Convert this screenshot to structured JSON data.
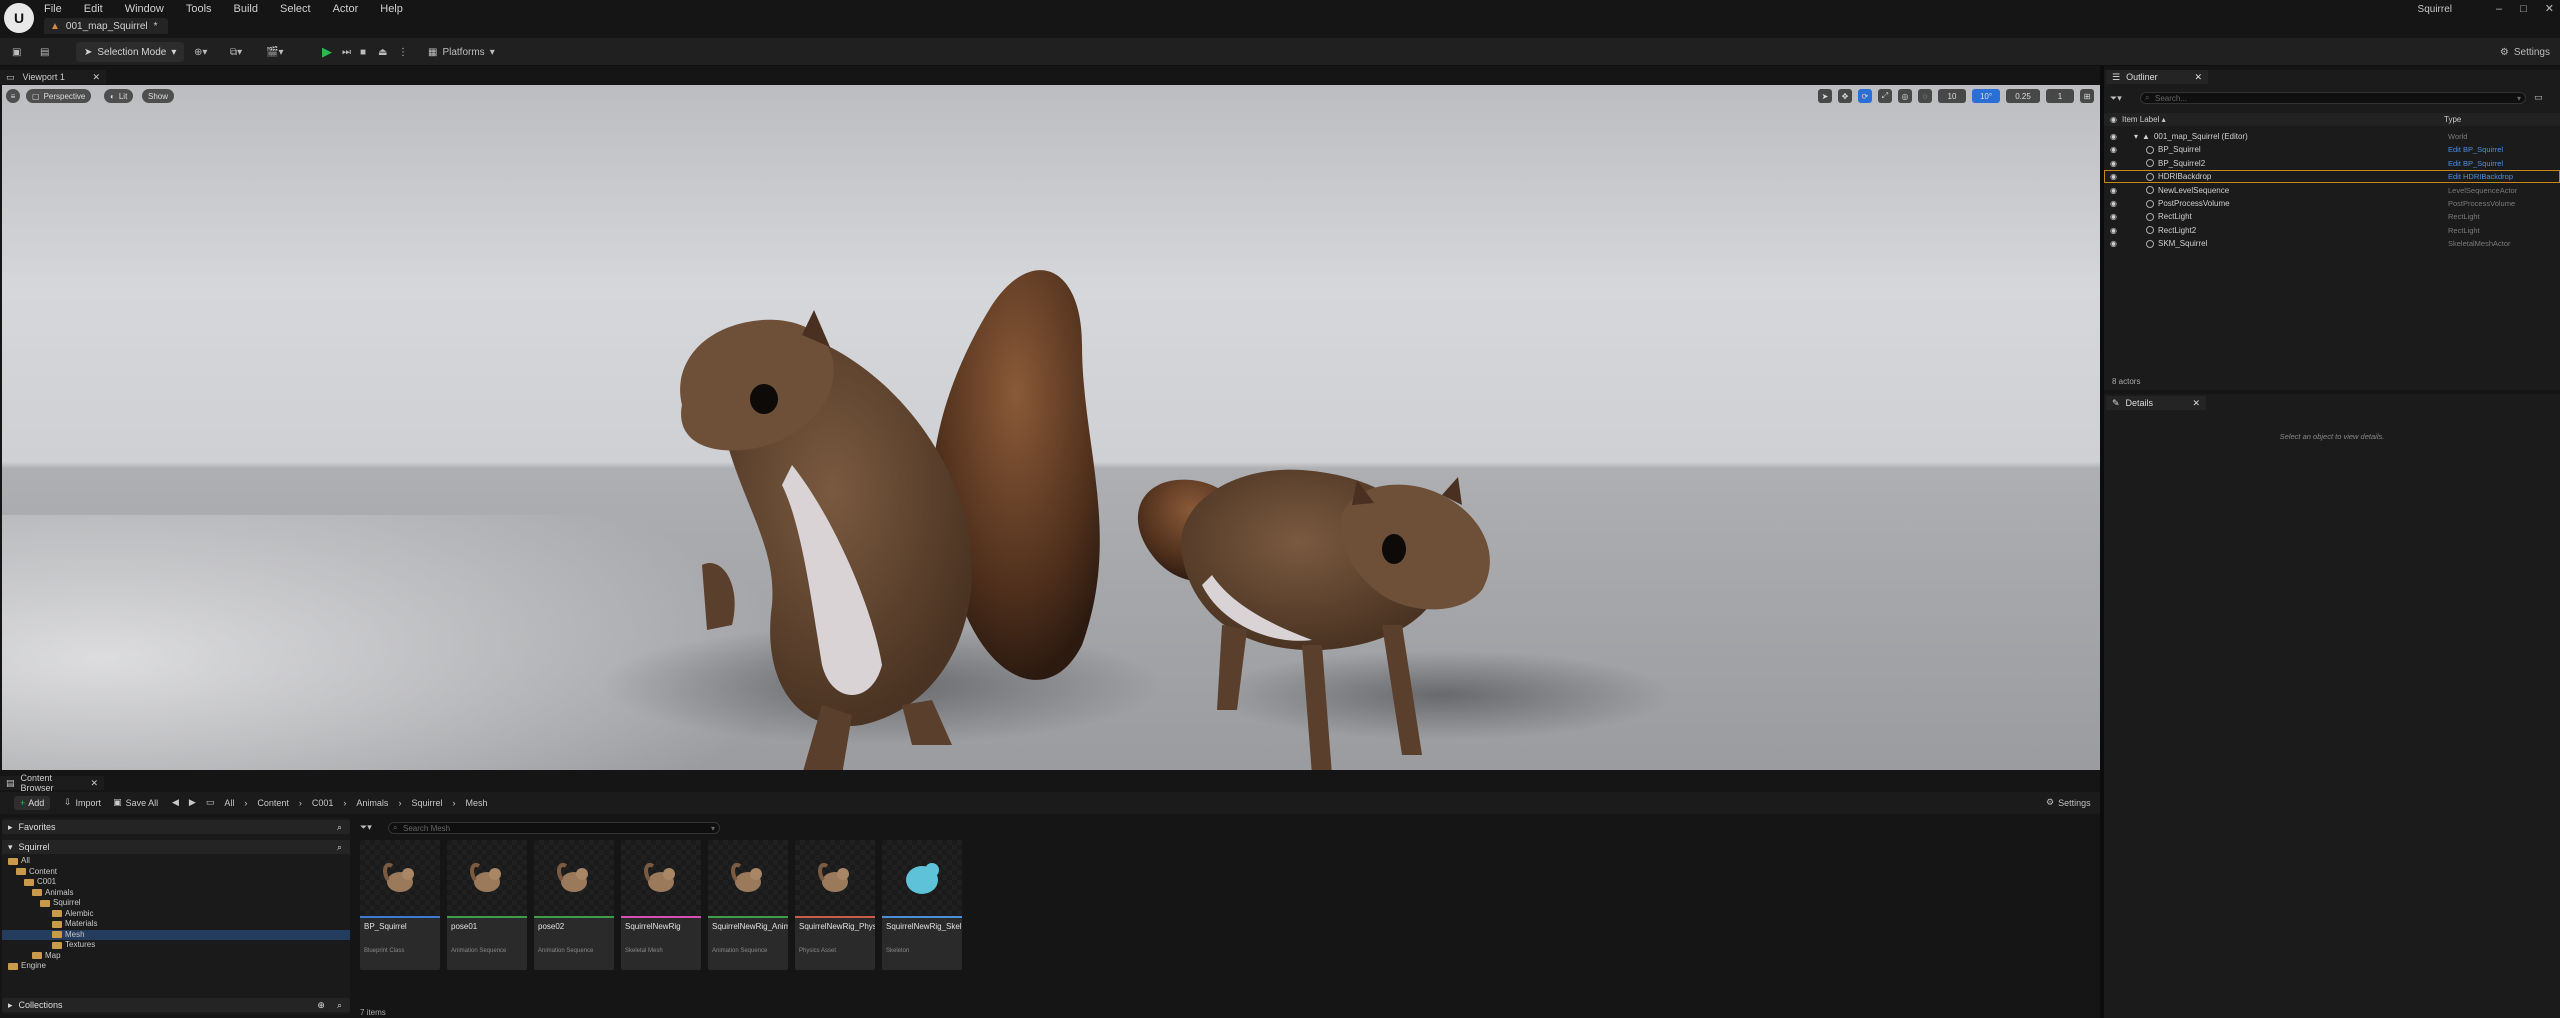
{
  "app": {
    "logo_text": "U",
    "project_name": "Squirrel",
    "map_tab": "001_map_Squirrel",
    "menu": [
      "File",
      "Edit",
      "Window",
      "Tools",
      "Build",
      "Select",
      "Actor",
      "Help"
    ],
    "window_controls": [
      "–",
      "□",
      "✕"
    ]
  },
  "toolbar": {
    "selection_mode": "Selection Mode",
    "platforms": "Platforms",
    "settings": "Settings"
  },
  "viewport": {
    "tab": "Viewport 1",
    "perspective": "Perspective",
    "lit": "Lit",
    "show": "Show",
    "grid_snap": "10",
    "rot_snap": "10°",
    "scale_snap": "0.25",
    "camera_speed": "1"
  },
  "content_browser": {
    "tab": "Content Browser",
    "add": "Add",
    "import": "Import",
    "save_all": "Save All",
    "settings": "Settings",
    "breadcrumbs": [
      "All",
      "Content",
      "C001",
      "Animals",
      "Squirrel",
      "Mesh"
    ],
    "favorites": "Favorites",
    "root": "Squirrel",
    "tree": [
      {
        "label": "All",
        "depth": 0
      },
      {
        "label": "Content",
        "depth": 1
      },
      {
        "label": "C001",
        "depth": 2
      },
      {
        "label": "Animals",
        "depth": 3
      },
      {
        "label": "Squirrel",
        "depth": 4
      },
      {
        "label": "Alembic",
        "depth": 5
      },
      {
        "label": "Materials",
        "depth": 5
      },
      {
        "label": "Mesh",
        "depth": 5,
        "selected": true
      },
      {
        "label": "Textures",
        "depth": 5
      },
      {
        "label": "Map",
        "depth": 3
      },
      {
        "label": "Engine",
        "depth": 0
      }
    ],
    "collections": "Collections",
    "search_placeholder": "Search Mesh",
    "assets": [
      {
        "name": "BP_Squirrel",
        "type": "Blueprint Class",
        "color": "#3b7bd4"
      },
      {
        "name": "pose01",
        "type": "Animation Sequence",
        "color": "#3f9c4a"
      },
      {
        "name": "pose02",
        "type": "Animation Sequence",
        "color": "#3f9c4a"
      },
      {
        "name": "SquirrelNewRig",
        "type": "Skeletal Mesh",
        "color": "#d64fb6"
      },
      {
        "name": "SquirrelNewRig_Anim",
        "type": "Animation Sequence",
        "color": "#3f9c4a"
      },
      {
        "name": "SquirrelNewRig_PhysicsAsset",
        "type": "Physics Asset",
        "color": "#c95b4b"
      },
      {
        "name": "SquirrelNewRig_Skeleton",
        "type": "Skeleton",
        "color": "#4a8fd8"
      }
    ],
    "item_count": "7 items"
  },
  "outliner": {
    "tab": "Outliner",
    "search_placeholder": "Search...",
    "col_label": "Item Label",
    "col_type": "Type",
    "rows": [
      {
        "label": "001_map_Squirrel (Editor)",
        "type": "World",
        "link": false,
        "indent": 0
      },
      {
        "label": "BP_Squirrel",
        "type": "Edit BP_Squirrel",
        "link": true,
        "indent": 1
      },
      {
        "label": "BP_Squirrel2",
        "type": "Edit BP_Squirrel",
        "link": true,
        "indent": 1
      },
      {
        "label": "HDRIBackdrop",
        "type": "Edit HDRIBackdrop",
        "link": true,
        "indent": 1,
        "selected": true
      },
      {
        "label": "NewLevelSequence",
        "type": "LevelSequenceActor",
        "link": false,
        "indent": 1
      },
      {
        "label": "PostProcessVolume",
        "type": "PostProcessVolume",
        "link": false,
        "indent": 1
      },
      {
        "label": "RectLight",
        "type": "RectLight",
        "link": false,
        "indent": 1
      },
      {
        "label": "RectLight2",
        "type": "RectLight",
        "link": false,
        "indent": 1
      },
      {
        "label": "SKM_Squirrel",
        "type": "SkeletalMeshActor",
        "link": false,
        "indent": 1
      }
    ],
    "actor_count": "8 actors"
  },
  "details": {
    "tab": "Details",
    "hint": "Select an object to view details."
  }
}
